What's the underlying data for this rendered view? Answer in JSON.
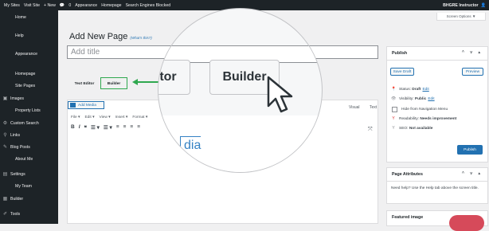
{
  "topbar": {
    "items": [
      "My Sites",
      "Visit Site",
      "+ New",
      "0",
      "Appearance",
      "Homepage",
      "Search Engines Blocked"
    ],
    "user": "BHGRE Instructor"
  },
  "sidebar": {
    "items": [
      "Home",
      "Help",
      "Appearance",
      "Homepage",
      "Site Pages",
      "Images",
      "Property Lists",
      "Custom Search",
      "Links",
      "Blog Posts",
      "About Me",
      "Settings",
      "My Team",
      "Builder",
      "Tools"
    ]
  },
  "screen_options": "Screen Options ▼",
  "page": {
    "title": "Add New Page",
    "whats_this": "(What's this?)",
    "title_placeholder": "Add title"
  },
  "editor_tabs": {
    "text_editor": "Text Editor",
    "builder": "Builder"
  },
  "zoom": {
    "left_tab_partial": "tor",
    "builder_tab": "Builder",
    "text_partial": "dia"
  },
  "editor": {
    "add_media": "Add Media",
    "visual": "Visual",
    "text": "Text",
    "menus": [
      "File ▾",
      "Edit ▾",
      "View ▾",
      "Insert ▾",
      "Format ▾"
    ],
    "toolbar": [
      "B",
      "I",
      "❝",
      "☰ ▾",
      "☰ ▾",
      "≡",
      "≡",
      "≡",
      "≡"
    ]
  },
  "publish": {
    "title": "Publish",
    "save_draft": "Save Draft",
    "preview": "Preview",
    "status_label": "Status:",
    "status_value": "Draft",
    "visibility_label": "Visibility:",
    "visibility_value": "Public",
    "edit": "Edit",
    "hide_nav": "Hide from Navigation Menu",
    "readability_label": "Readability:",
    "readability_value": "Needs improvement",
    "seo_label": "SEO:",
    "seo_value": "Not available",
    "publish_button": "Publish"
  },
  "page_attributes": {
    "title": "Page Attributes",
    "help": "Need help? Use the Help tab above the screen title."
  },
  "featured_image": {
    "title": "Featured image"
  },
  "colors": {
    "admin_bar": "#1d2327",
    "accent": "#2271b1",
    "highlight": "#2fa84f"
  }
}
